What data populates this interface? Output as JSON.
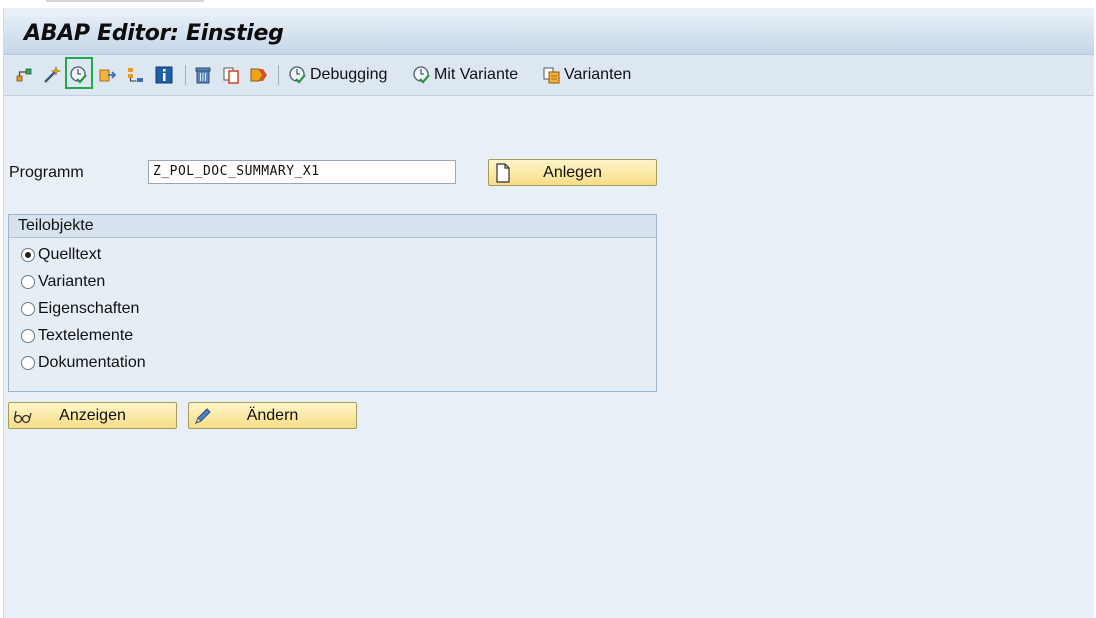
{
  "window": {
    "title": "ABAP Editor: Einstieg"
  },
  "toolbar": {
    "icons": [
      "hierarchy-icon",
      "magic-wand-icon",
      "check-icon",
      "export-icon",
      "where-used-icon",
      "info-icon",
      "delete-icon",
      "copy-icon",
      "rename-icon"
    ],
    "selected_icon": "check-icon",
    "buttons": [
      {
        "label": "Debugging",
        "icon": "debug-clock-icon"
      },
      {
        "label": "Mit Variante",
        "icon": "variant-clock-icon"
      },
      {
        "label": "Varianten",
        "icon": "variants-icon"
      }
    ]
  },
  "program": {
    "label": "Programm",
    "value": "Z_POL_DOC_SUMMARY_X1",
    "create_button": "Anlegen"
  },
  "subobjects": {
    "title": "Teilobjekte",
    "options": [
      {
        "label": "Quelltext",
        "selected": true
      },
      {
        "label": "Varianten",
        "selected": false
      },
      {
        "label": "Eigenschaften",
        "selected": false
      },
      {
        "label": "Textelemente",
        "selected": false
      },
      {
        "label": "Dokumentation",
        "selected": false
      }
    ]
  },
  "actions": {
    "display_button": "Anzeigen",
    "change_button": "Ändern"
  },
  "colors": {
    "background": "#e8eff6",
    "button_yellow": "#f6dd86",
    "selection_green": "#22a84a"
  }
}
